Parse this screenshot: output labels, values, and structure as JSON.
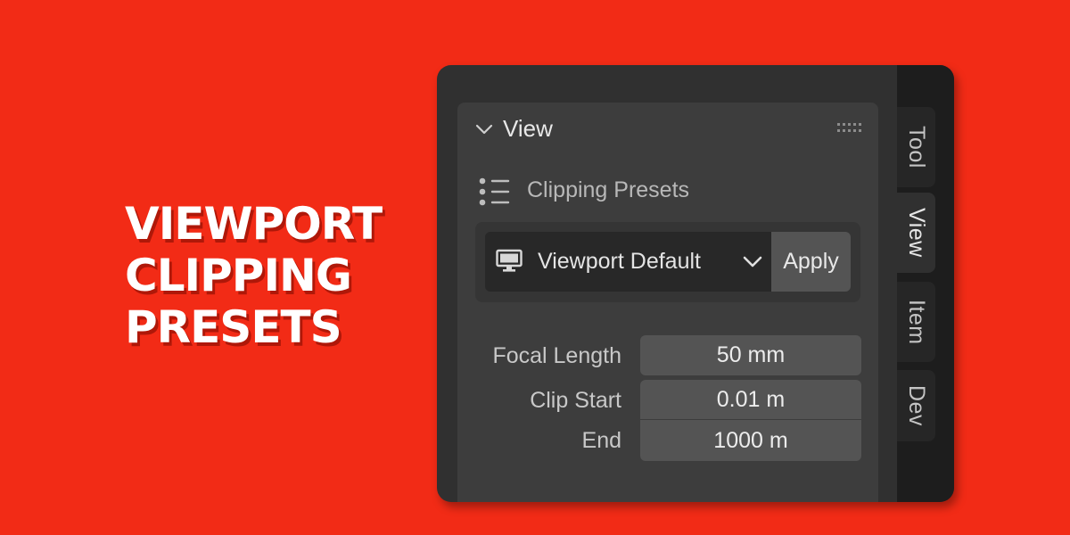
{
  "hero": {
    "line1": "VIEWPORT",
    "line2": "CLIPPING",
    "line3": "PRESETS"
  },
  "panel": {
    "title": "View",
    "presets_label": "Clipping Presets",
    "preset_selected": "Viewport Default",
    "apply_label": "Apply",
    "properties": {
      "focal_length": {
        "label": "Focal Length",
        "value": "50 mm"
      },
      "clip_start": {
        "label": "Clip Start",
        "value": "0.01 m"
      },
      "clip_end": {
        "label": "End",
        "value": "1000 m"
      }
    }
  },
  "tabs": [
    {
      "label": "Tool",
      "active": false
    },
    {
      "label": "View",
      "active": true
    },
    {
      "label": "Item",
      "active": false
    },
    {
      "label": "Dev",
      "active": false
    }
  ],
  "colors": {
    "background": "#f22b16",
    "window": "#303030",
    "panel": "#3d3d3d",
    "field": "#545454",
    "dropdown": "#282828",
    "tab_strip": "#1d1d1d"
  },
  "icons": {
    "header_collapse": "chevron-down-icon",
    "header_grip": "drag-grip-icon",
    "presets": "list-icon",
    "preset_type": "monitor-icon",
    "dropdown": "chevron-down-icon"
  }
}
